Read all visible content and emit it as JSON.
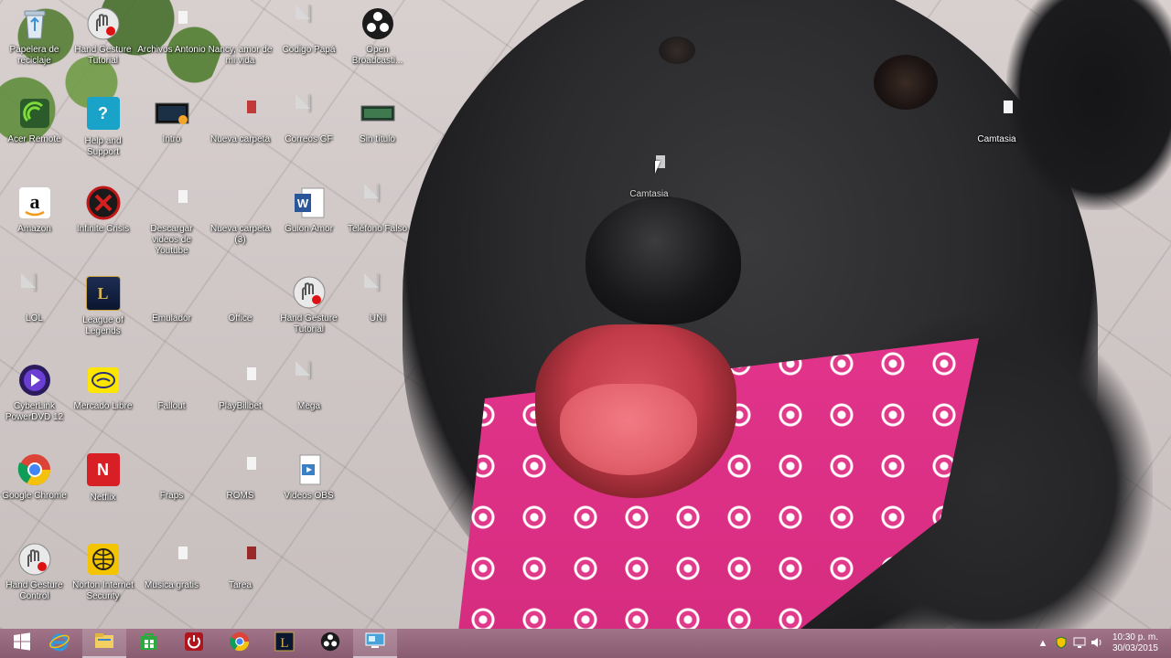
{
  "desktop": {
    "icons": [
      {
        "label": "Papelera de reciclaje",
        "icon": "recycle-bin-icon"
      },
      {
        "label": "Hand Gesture Tutorial",
        "icon": "hand-gesture-icon"
      },
      {
        "label": "Archivos Antonio",
        "icon": "folder-red-icon"
      },
      {
        "label": "Nancy, amor de mi vida",
        "icon": "folder-icon"
      },
      {
        "label": "Codigo Papá",
        "icon": "document-icon"
      },
      {
        "label": "Open Broadcasti...",
        "icon": "obs-icon"
      },
      {
        "label": "Acer Remote",
        "icon": "acer-remote-icon"
      },
      {
        "label": "Help and Support",
        "icon": "help-icon"
      },
      {
        "label": "Intro",
        "icon": "video-icon"
      },
      {
        "label": "Nueva carpeta",
        "icon": "folder-icon"
      },
      {
        "label": "Correos GF",
        "icon": "document-icon"
      },
      {
        "label": "Sin título",
        "icon": "image-icon"
      },
      {
        "label": "Amazon",
        "icon": "amazon-icon"
      },
      {
        "label": "Infinite Crisis",
        "icon": "infinite-crisis-icon"
      },
      {
        "label": "Descargar videos de Youtube",
        "icon": "folder-icon"
      },
      {
        "label": "Nueva carpeta (3)",
        "icon": "folder-icon"
      },
      {
        "label": "Guion Amor",
        "icon": "word-icon"
      },
      {
        "label": "Teléfono Falso",
        "icon": "document-icon"
      },
      {
        "label": "LOL",
        "icon": "document-icon"
      },
      {
        "label": "League of Legends",
        "icon": "league-icon"
      },
      {
        "label": "Emulador",
        "icon": "folder-icon"
      },
      {
        "label": "Office",
        "icon": "folder-icon"
      },
      {
        "label": "Hand Gesture Tutorial",
        "icon": "hand-gesture-icon"
      },
      {
        "label": "UNI",
        "icon": "document-icon"
      },
      {
        "label": "CyberLink PowerDVD 12",
        "icon": "powerdvd-icon"
      },
      {
        "label": "Mercado Libre",
        "icon": "mercado-libre-icon"
      },
      {
        "label": "Fallout",
        "icon": "folder-icon"
      },
      {
        "label": "PlayBillbet",
        "icon": "folder-icon"
      },
      {
        "label": "Mega",
        "icon": "document-icon"
      },
      {
        "label": "Google Chrome",
        "icon": "chrome-icon"
      },
      {
        "label": "Netflix",
        "icon": "netflix-icon"
      },
      {
        "label": "Fraps",
        "icon": "folder-icon"
      },
      {
        "label": "ROMS",
        "icon": "folder-icon"
      },
      {
        "label": "Videos OBS",
        "icon": "video-file-icon"
      },
      {
        "label": "Hand Gesture Control",
        "icon": "hand-gesture-icon"
      },
      {
        "label": "Norton Internet Security",
        "icon": "norton-icon"
      },
      {
        "label": "Musica gratis",
        "icon": "folder-icon"
      },
      {
        "label": "Tarea",
        "icon": "folder-icon"
      }
    ],
    "dragging_folder": {
      "label": "Camtasia"
    },
    "right_folder": {
      "label": "Camtasia"
    }
  },
  "taskbar": {
    "buttons": [
      {
        "name": "start",
        "icon": "windows-logo-icon"
      },
      {
        "name": "internet-explorer",
        "icon": "ie-icon"
      },
      {
        "name": "file-explorer",
        "icon": "file-explorer-icon"
      },
      {
        "name": "store",
        "icon": "store-icon"
      },
      {
        "name": "shutdown",
        "icon": "power-icon"
      },
      {
        "name": "chrome",
        "icon": "chrome-icon"
      },
      {
        "name": "league-of-legends",
        "icon": "league-icon"
      },
      {
        "name": "obs",
        "icon": "obs-icon"
      },
      {
        "name": "desktop-app",
        "icon": "remote-desktop-icon"
      }
    ],
    "tray": {
      "time": "10:30 p. m.",
      "date": "30/03/2015"
    }
  },
  "colors": {
    "taskbar": "#8e5f77",
    "bandana": "#e1348a"
  }
}
